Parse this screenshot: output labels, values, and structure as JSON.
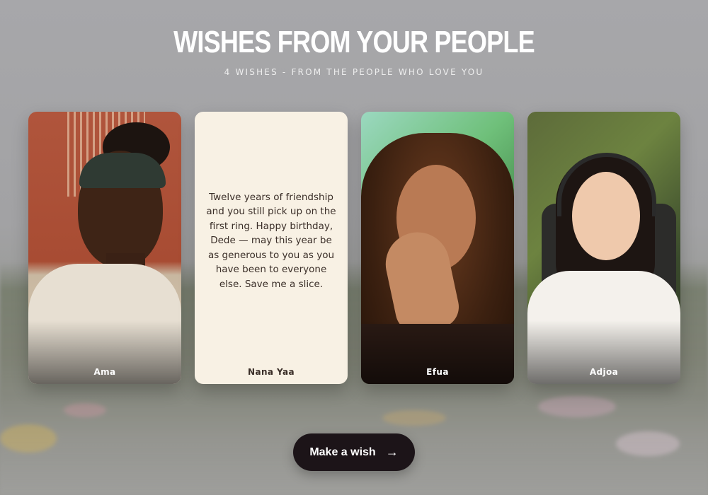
{
  "header": {
    "title": "WISHES FROM YOUR PEOPLE",
    "subtitle": "4 WISHES - FROM THE PEOPLE WHO LOVE YOU"
  },
  "cards": [
    {
      "name": "Ama",
      "type": "video"
    },
    {
      "name": "Nana Yaa",
      "type": "text",
      "message": "Twelve years of friendship and you still pick up on the first ring. Happy birthday, Dede — may this year be as generous to you as you have been to everyone else. Save me a slice."
    },
    {
      "name": "Efua",
      "type": "video"
    },
    {
      "name": "Adjoa",
      "type": "video"
    }
  ],
  "cta": {
    "label": "Make a wish",
    "arrow": "→"
  },
  "colors": {
    "text_card_bg": "#f8f1e4",
    "cta_bg": "#1c1418"
  }
}
